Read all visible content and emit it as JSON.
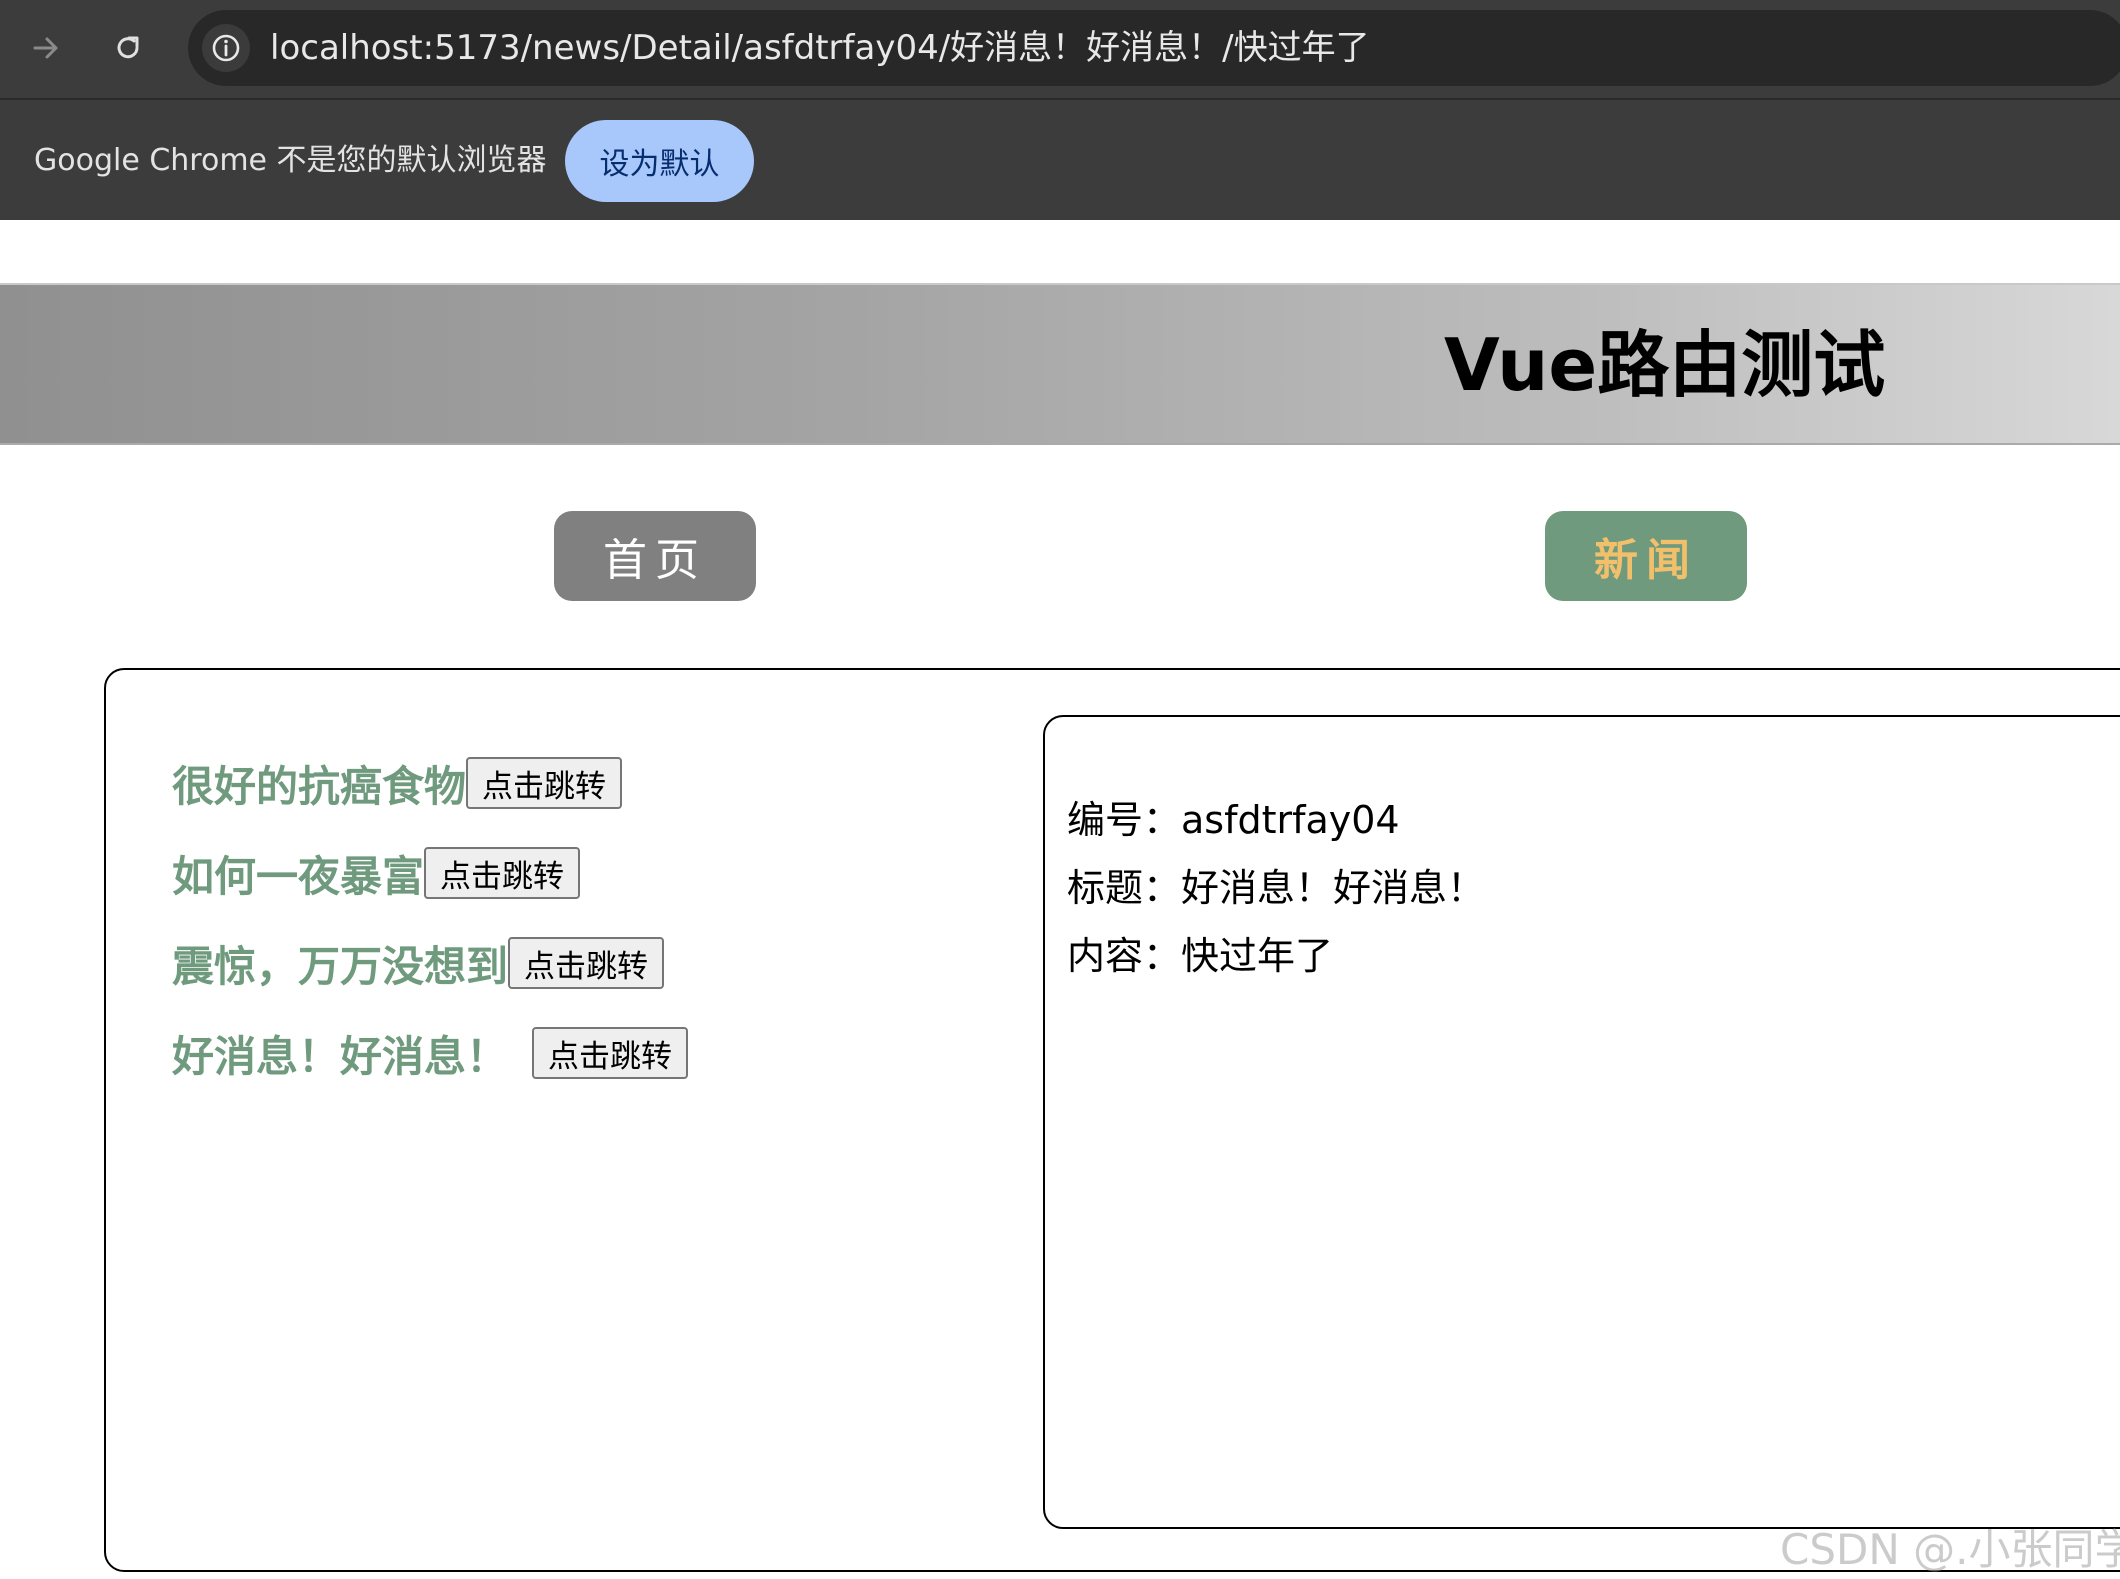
{
  "browser": {
    "url": "localhost:5173/news/Detail/asfdtrfay04/好消息！好消息！/快过年了",
    "infobar_message": "Google Chrome 不是您的默认浏览器",
    "set_default_label": "设为默认"
  },
  "header": {
    "title": "Vue路由测试"
  },
  "nav": {
    "home_label": "首页",
    "news_label": "新闻"
  },
  "news_list": [
    {
      "title": "很好的抗癌食物",
      "button_label": "点击跳转"
    },
    {
      "title": "如何一夜暴富",
      "button_label": "点击跳转"
    },
    {
      "title": "震惊，万万没想到",
      "button_label": "点击跳转"
    },
    {
      "title": "好消息！好消息！",
      "button_label": "点击跳转"
    }
  ],
  "detail": {
    "id_line": "编号：asfdtrfay04",
    "title_line": "标题：好消息！好消息！",
    "content_line": "内容：快过年了"
  },
  "watermark": "CSDN @.小张同学",
  "colors": {
    "accent_green": "#6f9a7e",
    "news_text": "#f2c06b",
    "home_bg": "#808080",
    "default_btn": "#a8c7fa"
  }
}
